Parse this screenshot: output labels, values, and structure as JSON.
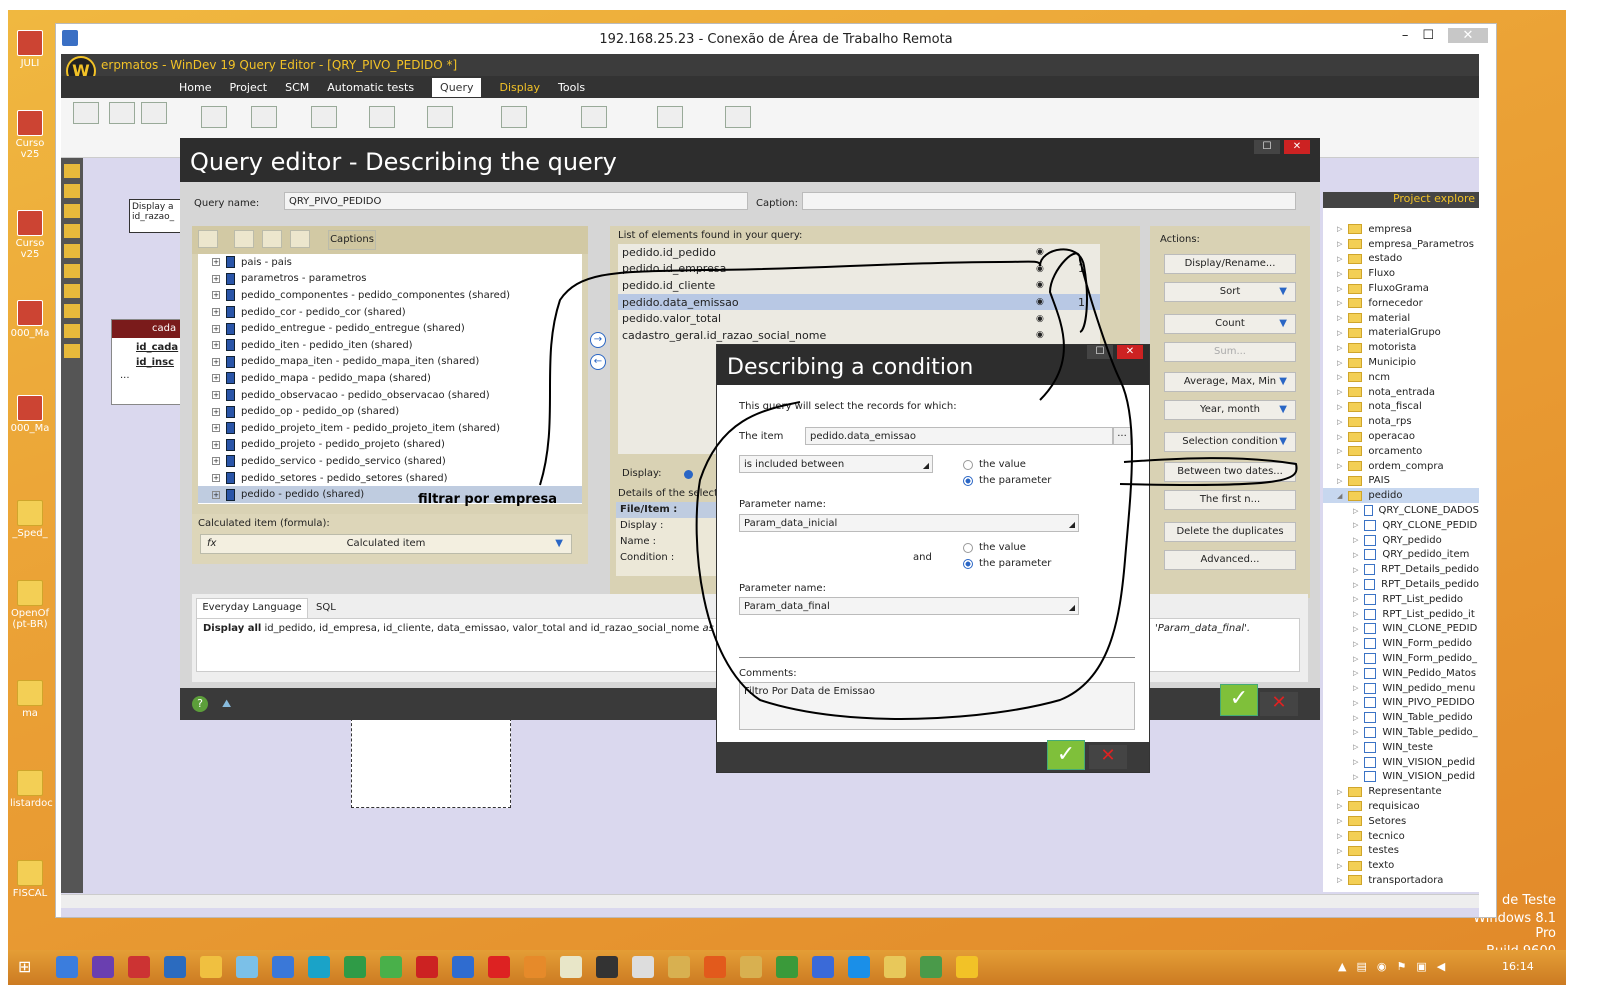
{
  "rdp": {
    "title": "192.168.25.23 - Conexão de Área de Trabalho Remota",
    "minimize": "–",
    "maximize": "☐",
    "close": "✕"
  },
  "windev": {
    "title": "erpmatos - WinDev 19  Query Editor - [QRY_PIVO_PEDIDO *]",
    "menu": [
      "Home",
      "Project",
      "SCM",
      "Automatic tests",
      "Query",
      "Display",
      "Tools"
    ]
  },
  "desktop_icons": [
    "JULI",
    "Curso v25",
    "Curso v25",
    "000_Ma",
    "000_Ma",
    "_Sped_",
    "OpenOf (pt-BR)",
    "ma",
    "listardoc",
    "FISCAL"
  ],
  "canvas_box": {
    "title_fragment": "Display a",
    "sub_fragment": "id_razao_",
    "cada": "cada",
    "row1": "id_cada",
    "row2": "id_insc",
    "row3": "..."
  },
  "query_editor": {
    "title": "Query editor - Describing the query",
    "query_name_label": "Query name:",
    "query_name_value": "QRY_PIVO_PEDIDO",
    "caption_label": "Caption:",
    "caption_value": "",
    "captions_btn": "Captions",
    "tree_items": [
      {
        "text": "pais  -  pais",
        "sel": false
      },
      {
        "text": "parametros  -  parametros",
        "sel": false
      },
      {
        "text": "pedido_componentes  -  pedido_componentes (shared)",
        "sel": false
      },
      {
        "text": "pedido_cor  -  pedido_cor (shared)",
        "sel": false
      },
      {
        "text": "pedido_entregue  -  pedido_entregue (shared)",
        "sel": false
      },
      {
        "text": "pedido_iten  -  pedido_iten (shared)",
        "sel": false
      },
      {
        "text": "pedido_mapa_iten  -  pedido_mapa_iten (shared)",
        "sel": false
      },
      {
        "text": "pedido_mapa  -  pedido_mapa (shared)",
        "sel": false
      },
      {
        "text": "pedido_observacao  -  pedido_observacao (shared)",
        "sel": false
      },
      {
        "text": "pedido_op  -  pedido_op (shared)",
        "sel": false
      },
      {
        "text": "pedido_projeto_item  -  pedido_projeto_item (shared)",
        "sel": false
      },
      {
        "text": "pedido_projeto  -  pedido_projeto (shared)",
        "sel": false
      },
      {
        "text": "pedido_servico  -  pedido_servico (shared)",
        "sel": false
      },
      {
        "text": "pedido_setores  -  pedido_setores (shared)",
        "sel": false
      },
      {
        "text": "pedido  -  pedido (shared)",
        "sel": true
      }
    ],
    "handwritten_note": "filtrar por empresa",
    "calc_label": "Calculated item (formula):",
    "calc_btn": "Calculated item",
    "elements_label": "List of elements found in your query:",
    "elements": [
      {
        "text": "pedido.id_pedido",
        "num": "",
        "sel": false
      },
      {
        "text": "pedido.id_empresa",
        "num": "1",
        "sel": false
      },
      {
        "text": "pedido.id_cliente",
        "num": "",
        "sel": false
      },
      {
        "text": "pedido.data_emissao",
        "num": "1",
        "sel": true
      },
      {
        "text": "pedido.valor_total",
        "num": "",
        "sel": false
      },
      {
        "text": "cadastro_geral.id_razao_social_nome",
        "num": "",
        "sel": false
      }
    ],
    "display_label": "Display:",
    "details_label": "Details of the selecte",
    "details_rows": [
      "File/Item :",
      "Display :",
      "Name :",
      "Condition :"
    ],
    "actions_label": "Actions:",
    "actions": [
      {
        "text": "Display/Rename...",
        "arrow": false,
        "disabled": false
      },
      {
        "text": "Sort",
        "arrow": true,
        "disabled": false
      },
      {
        "text": "Count",
        "arrow": true,
        "disabled": false
      },
      {
        "text": "Sum...",
        "arrow": false,
        "disabled": true
      },
      {
        "text": "Average, Max, Min",
        "arrow": true,
        "disabled": false
      },
      {
        "text": "Year, month",
        "arrow": true,
        "disabled": false
      },
      {
        "text": "Selection condition",
        "arrow": true,
        "disabled": false
      },
      {
        "text": "Between two dates...",
        "arrow": false,
        "disabled": false
      },
      {
        "text": "The first n...",
        "arrow": false,
        "disabled": false
      },
      {
        "text": "Delete the duplicates",
        "arrow": false,
        "disabled": false
      },
      {
        "text": "Advanced...",
        "arrow": false,
        "disabled": false
      }
    ],
    "tab_everyday": "Everyday Language",
    "tab_sql": "SQL",
    "summary_bold": "Display all",
    "summary_text": "id_pedido, id_empresa, id_cliente, data_emissao, valor_total and id_razao_social_nome",
    "summary_italic": "as id_empresa",
    "summary_tail": "'Param_data_final'."
  },
  "condition": {
    "title": "Describing a condition",
    "intro": "This query will select the records for which:",
    "item_label": "The item",
    "item_value": "pedido.data_emissao",
    "item_more": "...",
    "operator": "is included between",
    "opt_value": "the value",
    "opt_param": "the parameter",
    "param1_label": "Parameter name:",
    "param1_value": "Param_data_inicial",
    "and_label": "and",
    "param2_label": "Parameter name:",
    "param2_value": "Param_data_final",
    "comments_label": "Comments:",
    "comments_value": "Filtro Por Data de Emissao"
  },
  "explorer": {
    "title": "Project explore",
    "items": [
      {
        "text": "empresa",
        "type": "folder",
        "indent": 0,
        "sel": false
      },
      {
        "text": "empresa_Parametros",
        "type": "folder",
        "indent": 0,
        "sel": false
      },
      {
        "text": "estado",
        "type": "folder",
        "indent": 0,
        "sel": false
      },
      {
        "text": "Fluxo",
        "type": "folder",
        "indent": 0,
        "sel": false
      },
      {
        "text": "FluxoGrama",
        "type": "folder",
        "indent": 0,
        "sel": false
      },
      {
        "text": "fornecedor",
        "type": "folder",
        "indent": 0,
        "sel": false
      },
      {
        "text": "material",
        "type": "folder",
        "indent": 0,
        "sel": false
      },
      {
        "text": "materialGrupo",
        "type": "folder",
        "indent": 0,
        "sel": false
      },
      {
        "text": "motorista",
        "type": "folder",
        "indent": 0,
        "sel": false
      },
      {
        "text": "Municipio",
        "type": "folder",
        "indent": 0,
        "sel": false
      },
      {
        "text": "ncm",
        "type": "folder",
        "indent": 0,
        "sel": false
      },
      {
        "text": "nota_entrada",
        "type": "folder",
        "indent": 0,
        "sel": false
      },
      {
        "text": "nota_fiscal",
        "type": "folder",
        "indent": 0,
        "sel": false
      },
      {
        "text": "nota_rps",
        "type": "folder",
        "indent": 0,
        "sel": false
      },
      {
        "text": "operacao",
        "type": "folder",
        "indent": 0,
        "sel": false
      },
      {
        "text": "orcamento",
        "type": "folder",
        "indent": 0,
        "sel": false
      },
      {
        "text": "ordem_compra",
        "type": "folder",
        "indent": 0,
        "sel": false
      },
      {
        "text": "PAIS",
        "type": "folder",
        "indent": 0,
        "sel": false
      },
      {
        "text": "pedido",
        "type": "folder",
        "indent": 0,
        "sel": true
      },
      {
        "text": "QRY_CLONE_DADOS",
        "type": "doc",
        "indent": 1,
        "sel": false
      },
      {
        "text": "QRY_CLONE_PEDID",
        "type": "doc",
        "indent": 1,
        "sel": false
      },
      {
        "text": "QRY_pedido",
        "type": "doc",
        "indent": 1,
        "sel": false
      },
      {
        "text": "QRY_pedido_item",
        "type": "doc",
        "indent": 1,
        "sel": false
      },
      {
        "text": "RPT_Details_pedido",
        "type": "doc",
        "indent": 1,
        "sel": false
      },
      {
        "text": "RPT_Details_pedido",
        "type": "doc",
        "indent": 1,
        "sel": false
      },
      {
        "text": "RPT_List_pedido",
        "type": "doc",
        "indent": 1,
        "sel": false
      },
      {
        "text": "RPT_List_pedido_it",
        "type": "doc",
        "indent": 1,
        "sel": false
      },
      {
        "text": "WIN_CLONE_PEDID",
        "type": "doc",
        "indent": 1,
        "sel": false
      },
      {
        "text": "WIN_Form_pedido",
        "type": "doc",
        "indent": 1,
        "sel": false
      },
      {
        "text": "WIN_Form_pedido_",
        "type": "doc",
        "indent": 1,
        "sel": false
      },
      {
        "text": "WIN_Pedido_Matos",
        "type": "doc",
        "indent": 1,
        "sel": false
      },
      {
        "text": "WIN_pedido_menu",
        "type": "doc",
        "indent": 1,
        "sel": false
      },
      {
        "text": "WIN_PIVO_PEDIDO",
        "type": "doc",
        "indent": 1,
        "sel": false
      },
      {
        "text": "WIN_Table_pedido",
        "type": "doc",
        "indent": 1,
        "sel": false
      },
      {
        "text": "WIN_Table_pedido_",
        "type": "doc",
        "indent": 1,
        "sel": false
      },
      {
        "text": "WIN_teste",
        "type": "doc",
        "indent": 1,
        "sel": false
      },
      {
        "text": "WIN_VISION_pedid",
        "type": "doc",
        "indent": 1,
        "sel": false
      },
      {
        "text": "WIN_VISION_pedid",
        "type": "doc",
        "indent": 1,
        "sel": false
      },
      {
        "text": "Representante",
        "type": "folder",
        "indent": 0,
        "sel": false
      },
      {
        "text": "requisicao",
        "type": "folder",
        "indent": 0,
        "sel": false
      },
      {
        "text": "Setores",
        "type": "folder",
        "indent": 0,
        "sel": false
      },
      {
        "text": "tecnico",
        "type": "folder",
        "indent": 0,
        "sel": false
      },
      {
        "text": "testes",
        "type": "folder",
        "indent": 0,
        "sel": false
      },
      {
        "text": "texto",
        "type": "folder",
        "indent": 0,
        "sel": false
      },
      {
        "text": "transportadora",
        "type": "folder",
        "indent": 0,
        "sel": false
      }
    ]
  },
  "watermark": {
    "line1": "de Teste",
    "line2": "Windows 8.1 Pro",
    "line3": "Build 9600"
  },
  "taskbar": {
    "clock": "16:14"
  }
}
